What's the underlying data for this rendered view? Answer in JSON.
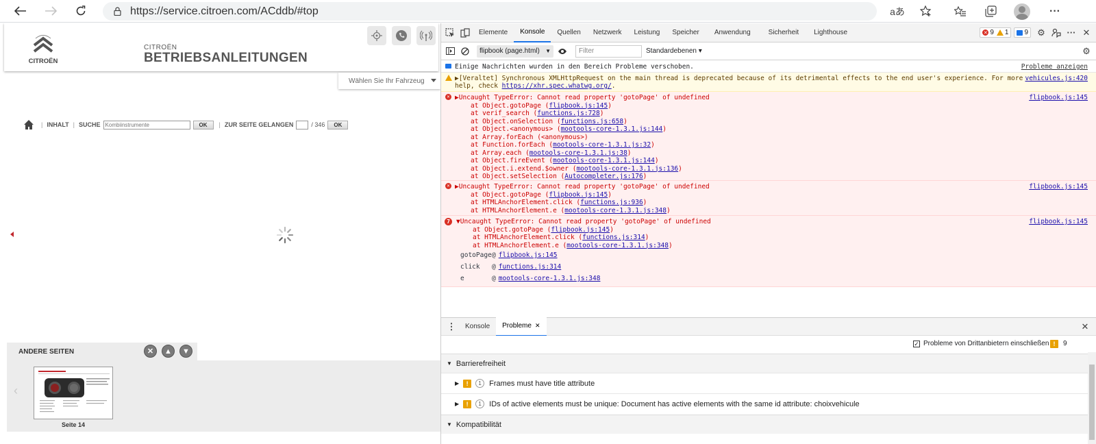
{
  "browser": {
    "url": "https://service.citroen.com/ACddb/#top",
    "icons": [
      "back-icon",
      "forward-icon",
      "refresh-icon",
      "lock-icon",
      "read-aloud-icon",
      "add-favorite-icon",
      "favorites-icon",
      "collections-icon",
      "profile-icon",
      "more-icon"
    ]
  },
  "page": {
    "brand_small": "CITROËN",
    "brand_title": "BETRIEBSANLEITUNGEN",
    "logo_text": "CITROËN",
    "vehicle_select": "Wählen Sie Ihr Fahrzeug",
    "toolbar": {
      "inhalt": "INHALT",
      "suche": "SUCHE",
      "search_placeholder": "Kombiinstrumente",
      "ok": "OK",
      "goto": "ZUR SEITE GELANGEN",
      "total_pages": "/ 346",
      "ok2": "OK"
    },
    "other_pages": "ANDERE SEITEN",
    "thumb_label": "Seite 14"
  },
  "devtools": {
    "tabs": [
      "Elemente",
      "Konsole",
      "Quellen",
      "Netzwerk",
      "Leistung",
      "Speicher",
      "Anwendung",
      "Sicherheit",
      "Lighthouse"
    ],
    "active_tab": "Konsole",
    "badges": {
      "errors": "9",
      "warnings": "1",
      "info": "9"
    },
    "context": "flipbook (page.html)",
    "filter_placeholder": "Filter",
    "levels": "Standardebenen ▾",
    "messages": {
      "info": "Einige Nachrichten wurden in den Bereich Probleme verschoben.",
      "info_link": "Probleme anzeigen",
      "warn_line1": "▶[Veraltet] Synchronous XMLHttpRequest on the main thread is deprecated because of its detrimental effects to the end user's experience. For more",
      "warn_line2_pre": "help, check ",
      "warn_line2_link": "https://xhr.spec.whatwg.org/",
      "warn_line2_post": ".",
      "warn_src": "vehicules.js:420",
      "err1_title": "▶Uncaught TypeError: Cannot read property 'gotoPage' of undefined",
      "err1_src": "flipbook.js:145",
      "err1_stack": [
        {
          "pre": "at Object.gotoPage (",
          "link": "flipbook.js:145",
          "post": ")"
        },
        {
          "pre": "at verif_search (",
          "link": "functions.js:728",
          "post": ")"
        },
        {
          "pre": "at Object.onSelection (",
          "link": "functions.js:658",
          "post": ")"
        },
        {
          "pre": "at Object.<anonymous> (",
          "link": "mootools-core-1.3.1.js:144",
          "post": ")"
        },
        {
          "pre": "at Array.forEach (<anonymous>)",
          "link": "",
          "post": ""
        },
        {
          "pre": "at Function.forEach (",
          "link": "mootools-core-1.3.1.js:32",
          "post": ")"
        },
        {
          "pre": "at Array.each (",
          "link": "mootools-core-1.3.1.js:38",
          "post": ")"
        },
        {
          "pre": "at Object.fireEvent (",
          "link": "mootools-core-1.3.1.js:144",
          "post": ")"
        },
        {
          "pre": "at Object.i.extend.$owner (",
          "link": "mootools-core-1.3.1.js:136",
          "post": ")"
        },
        {
          "pre": "at Object.setSelection (",
          "link": "Autocompleter.js:176",
          "post": ")"
        }
      ],
      "err2_title": "▶Uncaught TypeError: Cannot read property 'gotoPage' of undefined",
      "err2_src": "flipbook.js:145",
      "err2_stack": [
        {
          "pre": "at Object.gotoPage (",
          "link": "flipbook.js:145",
          "post": ")"
        },
        {
          "pre": "at HTMLAnchorElement.click (",
          "link": "functions.js:936",
          "post": ")"
        },
        {
          "pre": "at HTMLAnchorElement.e (",
          "link": "mootools-core-1.3.1.js:348",
          "post": ")"
        }
      ],
      "err3_count": "7",
      "err3_title": "▼Uncaught TypeError: Cannot read property 'gotoPage' of undefined",
      "err3_src": "flipbook.js:145",
      "err3_stack": [
        {
          "pre": "at Object.gotoPage (",
          "link": "flipbook.js:145",
          "post": ")"
        },
        {
          "pre": "at HTMLAnchorElement.click (",
          "link": "functions.js:314",
          "post": ")"
        },
        {
          "pre": "at HTMLAnchorElement.e (",
          "link": "mootools-core-1.3.1.js:348",
          "post": ")"
        }
      ],
      "err3_frames": [
        {
          "name": "gotoPage",
          "at": "@",
          "link": "flipbook.js:145"
        },
        {
          "name": "click",
          "at": "@",
          "link": "functions.js:314"
        },
        {
          "name": "e",
          "at": "@",
          "link": "mootools-core-1.3.1.js:348"
        }
      ]
    },
    "prompt": "›",
    "drawer": {
      "tabs": [
        "Konsole",
        "Probleme"
      ],
      "active": "Probleme",
      "third_party_label": "Probleme von Drittanbietern einschließen",
      "issue_count": "9",
      "cat1": "Barrierefreiheit",
      "issue1_count": "1",
      "issue1": "Frames must have title attribute",
      "issue2_count": "1",
      "issue2": "IDs of active elements must be unique: Document has active elements with the same id attribute: choixvehicule",
      "cat2": "Kompatibilität"
    }
  }
}
